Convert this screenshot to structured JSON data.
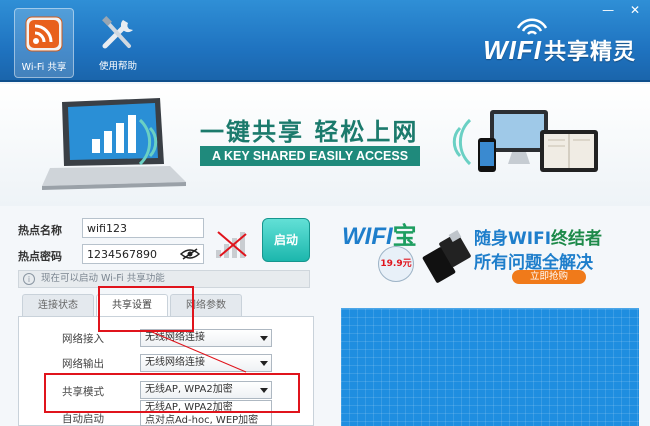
{
  "toolbar": {
    "wifi_share_label": "Wi-Fi 共享",
    "help_label": "使用帮助"
  },
  "window_controls": {
    "minimize": "—",
    "close": "✕"
  },
  "brand": {
    "logo_en": "WIFI",
    "logo_cn": "共享精灵"
  },
  "banner": {
    "slogan_cn": "一键共享 轻松上网",
    "slogan_en": "A KEY SHARED EASILY ACCESS"
  },
  "form": {
    "hotspot_name_label": "热点名称",
    "hotspot_name_value": "wifi123",
    "hotspot_password_label": "热点密码",
    "hotspot_password_value": "1234567890",
    "start_button": "启动",
    "status_text": "现在可以启动 Wi-Fi 共享功能"
  },
  "tabs": [
    {
      "label": "连接状态"
    },
    {
      "label": "共享设置"
    },
    {
      "label": "网络参数"
    }
  ],
  "settings": {
    "network_in_label": "网络接入",
    "network_in_value": "无线网络连接",
    "network_out_label": "网络输出",
    "network_out_value": "无线网络连接",
    "share_mode_label": "共享模式",
    "share_mode_value": "无线AP, WPA2加密",
    "auto_start_label": "自动启动",
    "dropdown_options": [
      "无线AP, WPA2加密",
      "点对点Ad-hoc, WEP加密"
    ]
  },
  "ad": {
    "logo": "WIFI",
    "logo_cn": "宝",
    "price": "19.9元",
    "title_line1_a": "随身WIFI",
    "title_line1_b": "终结者",
    "title_line2": "所有问题全解决",
    "buy_button": "立即抢购"
  },
  "colors": {
    "toolbar_blue": "#1f73c0",
    "accent_teal": "#1f8a7c",
    "highlight_red": "#e0141c",
    "ad_blue": "#1f8ee0"
  }
}
